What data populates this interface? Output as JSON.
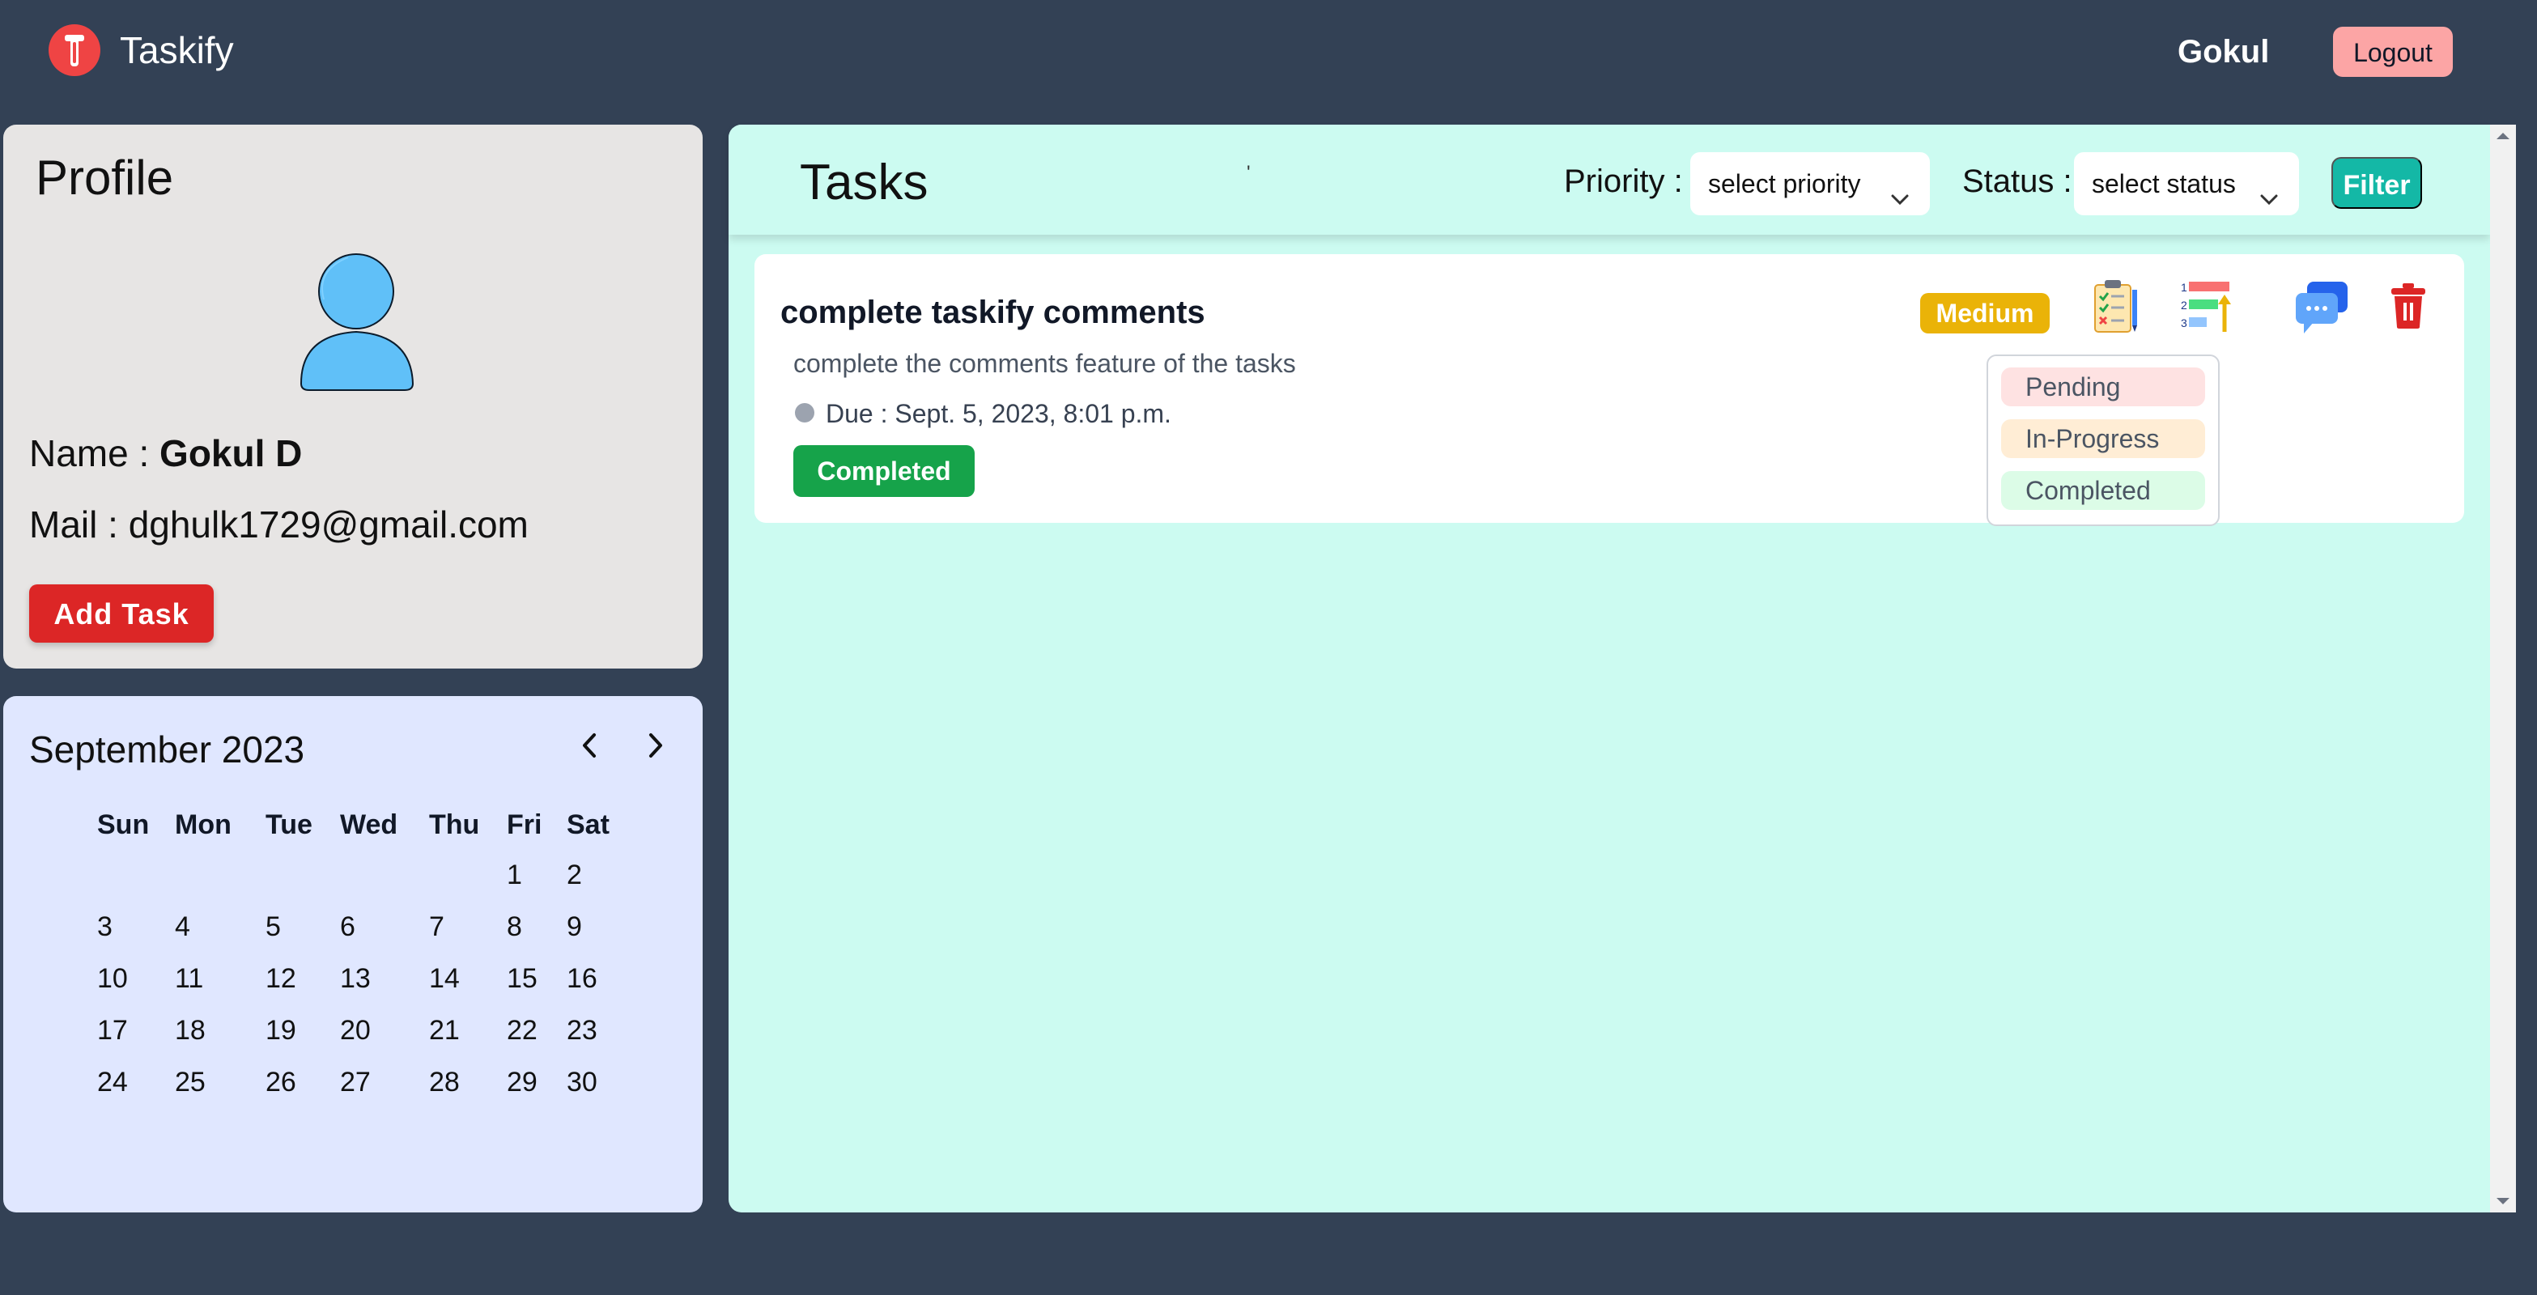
{
  "nav": {
    "brand": "Taskify",
    "user": "Gokul",
    "logout": "Logout"
  },
  "profile": {
    "title": "Profile",
    "name_label": "Name :",
    "name": "Gokul D",
    "mail_label": "Mail :",
    "mail": "dghulk1729@gmail.com",
    "add_task": "Add Task"
  },
  "calendar": {
    "title": "September 2023",
    "weekdays": [
      "Sun",
      "Mon",
      "Tue",
      "Wed",
      "Thu",
      "Fri",
      "Sat"
    ],
    "weeks": [
      [
        "",
        "",
        "",
        "",
        "",
        "1",
        "2"
      ],
      [
        "3",
        "4",
        "5",
        "6",
        "7",
        "8",
        "9"
      ],
      [
        "10",
        "11",
        "12",
        "13",
        "14",
        "15",
        "16"
      ],
      [
        "17",
        "18",
        "19",
        "20",
        "21",
        "22",
        "23"
      ],
      [
        "24",
        "25",
        "26",
        "27",
        "28",
        "29",
        "30"
      ]
    ]
  },
  "tasks": {
    "title": "Tasks",
    "tick": "'",
    "priority_label": "Priority :",
    "priority_placeholder": "select priority",
    "status_label": "Status :",
    "status_placeholder": "select status",
    "filter": "Filter",
    "items": [
      {
        "title": "complete taskify comments",
        "description": "complete the comments feature of the tasks",
        "due": "Due : Sept. 5, 2023, 8:01 p.m.",
        "status": "Completed",
        "priority": "Medium"
      }
    ],
    "status_options": [
      "Pending",
      "In-Progress",
      "Completed"
    ]
  },
  "colors": {
    "background": "#334155",
    "accent_teal": "#14b8a6",
    "priority_medium": "#eab308",
    "status_completed": "#16a34a",
    "danger": "#dc2626"
  }
}
